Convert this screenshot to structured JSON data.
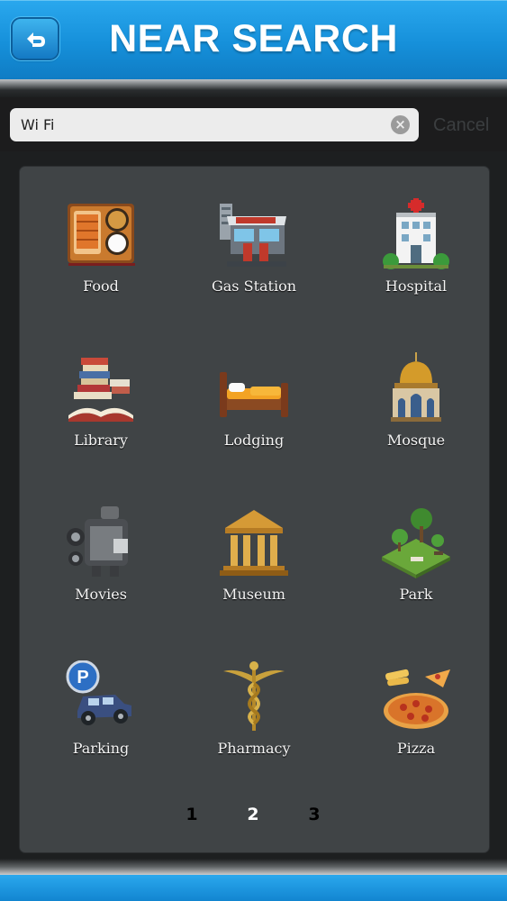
{
  "header": {
    "title": "NEAR SEARCH",
    "back_icon": "return-arrow-icon"
  },
  "search": {
    "value": "Wi Fi",
    "cancel_label": "Cancel"
  },
  "categories": [
    {
      "label": "Food",
      "icon": "food-tray-icon"
    },
    {
      "label": "Gas Station",
      "icon": "gas-station-icon"
    },
    {
      "label": "Hospital",
      "icon": "hospital-icon"
    },
    {
      "label": "Library",
      "icon": "books-icon"
    },
    {
      "label": "Lodging",
      "icon": "bed-icon"
    },
    {
      "label": "Mosque",
      "icon": "mosque-icon"
    },
    {
      "label": "Movies",
      "icon": "film-camera-icon"
    },
    {
      "label": "Museum",
      "icon": "museum-icon"
    },
    {
      "label": "Park",
      "icon": "park-icon"
    },
    {
      "label": "Parking",
      "icon": "parking-car-icon"
    },
    {
      "label": "Pharmacy",
      "icon": "caduceus-icon"
    },
    {
      "label": "Pizza",
      "icon": "pizza-icon"
    }
  ],
  "pagination": {
    "pages": [
      "1",
      "2",
      "3"
    ],
    "current": "2"
  },
  "colors": {
    "header_blue": "#1690da",
    "panel": "#404446",
    "background": "#1d1f20"
  }
}
